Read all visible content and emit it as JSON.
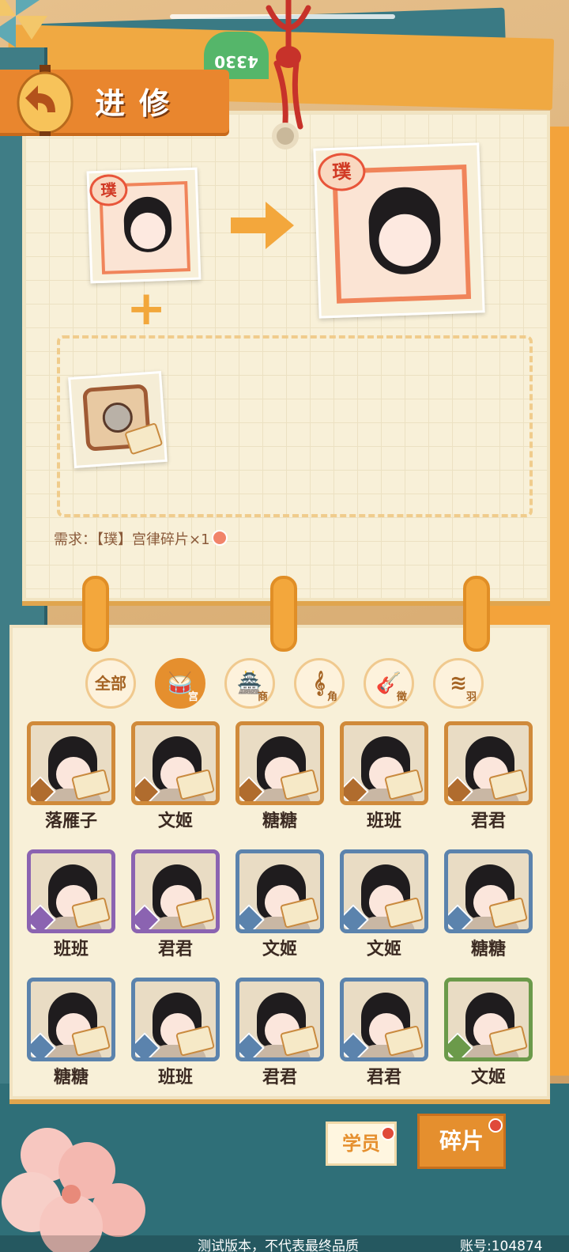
{
  "header": {
    "title": "进修"
  },
  "top_badge": "4330",
  "cards": {
    "source_seal": "璞",
    "result_seal": "璞"
  },
  "requirement": "需求：【璞】宫律碎片×1",
  "tabs": [
    {
      "label": "全部",
      "sub": "",
      "glyph": ""
    },
    {
      "label": "",
      "sub": "宫",
      "glyph": "🥁"
    },
    {
      "label": "",
      "sub": "商",
      "glyph": "🏯"
    },
    {
      "label": "",
      "sub": "角",
      "glyph": "𝄞"
    },
    {
      "label": "",
      "sub": "徵",
      "glyph": "🎸"
    },
    {
      "label": "",
      "sub": "羽",
      "glyph": "≋"
    }
  ],
  "characters": [
    {
      "name": "落雁子",
      "rarity": "gold"
    },
    {
      "name": "文姬",
      "rarity": "gold"
    },
    {
      "name": "糖糖",
      "rarity": "gold"
    },
    {
      "name": "班班",
      "rarity": "gold"
    },
    {
      "name": "君君",
      "rarity": "gold"
    },
    {
      "name": "班班",
      "rarity": "purple"
    },
    {
      "name": "君君",
      "rarity": "purple"
    },
    {
      "name": "文姬",
      "rarity": "blue"
    },
    {
      "name": "文姬",
      "rarity": "blue"
    },
    {
      "name": "糖糖",
      "rarity": "blue"
    },
    {
      "name": "糖糖",
      "rarity": "blue"
    },
    {
      "name": "班班",
      "rarity": "blue"
    },
    {
      "name": "君君",
      "rarity": "blue"
    },
    {
      "name": "君君",
      "rarity": "blue"
    },
    {
      "name": "文姬",
      "rarity": "green"
    }
  ],
  "bottom_buttons": {
    "students": "学员",
    "fragments": "碎片"
  },
  "footer": {
    "notice": "测试版本，不代表最终品质",
    "account": "账号:104874"
  }
}
